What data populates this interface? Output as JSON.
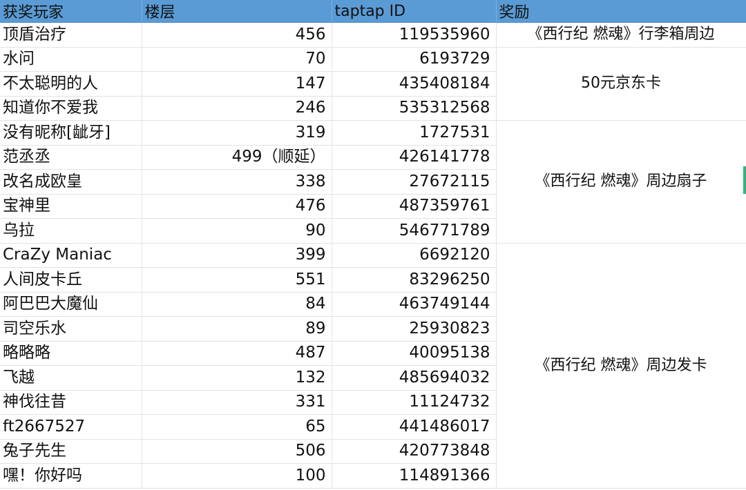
{
  "headers": {
    "name": "获奖玩家",
    "floor": "楼层",
    "id": "taptap ID",
    "reward": "奖励"
  },
  "rows": [
    {
      "name": "顶盾治疗",
      "floor": "456",
      "id": "119535960"
    },
    {
      "name": "水问",
      "floor": "70",
      "id": "6193729"
    },
    {
      "name": "不太聪明的人",
      "floor": "147",
      "id": "435408184"
    },
    {
      "name": "知道你不爱我",
      "floor": "246",
      "id": "535312568"
    },
    {
      "name": "没有昵称[龇牙]",
      "floor": "319",
      "id": "1727531"
    },
    {
      "name": "范丞丞",
      "floor": "499（顺延）",
      "id": "426141778"
    },
    {
      "name": "改名成欧皇",
      "floor": "338",
      "id": "27672115"
    },
    {
      "name": "宝神里",
      "floor": "476",
      "id": "487359761"
    },
    {
      "name": "乌拉",
      "floor": "90",
      "id": "546771789"
    },
    {
      "name": "CraZy Maniac",
      "floor": "399",
      "id": "6692120"
    },
    {
      "name": "人间皮卡丘",
      "floor": "551",
      "id": "83296250"
    },
    {
      "name": "阿巴巴大魔仙",
      "floor": "84",
      "id": "463749144"
    },
    {
      "name": "司空乐水",
      "floor": "89",
      "id": "25930823"
    },
    {
      "name": "略略略",
      "floor": "487",
      "id": "40095138"
    },
    {
      "name": "飞越",
      "floor": "132",
      "id": "485694032"
    },
    {
      "name": "神伐往昔",
      "floor": "331",
      "id": "11124732"
    },
    {
      "name": "ft2667527",
      "floor": "65",
      "id": "441486017"
    },
    {
      "name": "兔子先生",
      "floor": "506",
      "id": "420773848"
    },
    {
      "name": "嘿！你好吗",
      "floor": "100",
      "id": "114891366"
    }
  ],
  "rewards": [
    {
      "label": "《西行纪 燃魂》行李箱周边",
      "span": 1
    },
    {
      "label": "50元京东卡",
      "span": 3
    },
    {
      "label": "《西行纪 燃魂》周边扇子",
      "span": 5
    },
    {
      "label": "《西行纪 燃魂》周边发卡",
      "span": 10
    }
  ]
}
